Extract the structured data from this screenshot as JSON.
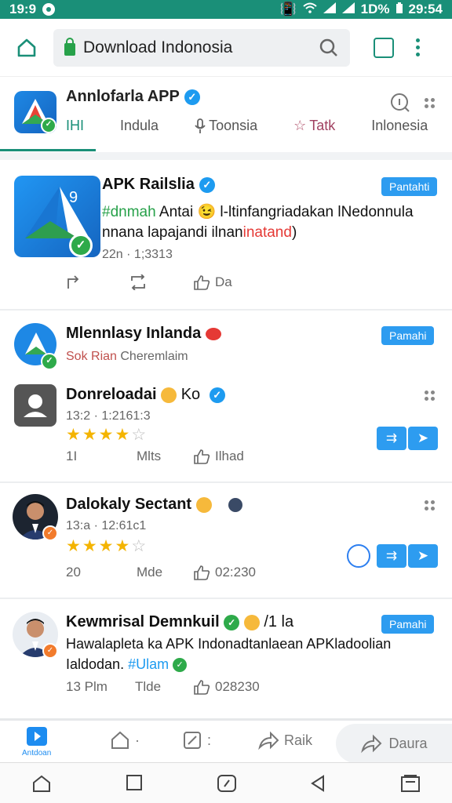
{
  "status_bar": {
    "time": "19:9",
    "battery": "1D%",
    "clock": "29:54"
  },
  "url_bar": {
    "url": "Download Indonosia"
  },
  "app_header": {
    "title": "Annlofarla APP",
    "tabs": [
      {
        "label": "IHI",
        "icon": "home-icon"
      },
      {
        "label": "Indula",
        "icon": ""
      },
      {
        "label": "Toonsia",
        "icon": "microphone-icon"
      },
      {
        "label": "Tatk",
        "icon": "star-icon"
      },
      {
        "label": "Inlonesia",
        "icon": ""
      }
    ]
  },
  "posts": [
    {
      "name": "APK Railslia",
      "tag": "Pantahti",
      "text_line1_prefix": "#dnmah",
      "text_line1": " Antai 😉 l-ltinfangriadakan lNedonnula",
      "text_line2_prefix": "nnana lapajandi ilnan",
      "text_line2_red": "inatand",
      "text_line2_suffix": ")",
      "meta": "22n  ·  1;3313",
      "actions": {
        "like": "Da"
      }
    },
    {
      "name": "Mlennlasy Inlanda",
      "tag": "Pamahi",
      "subtitle_red": "Sok Rian",
      "subtitle": " Cheremlaim"
    },
    {
      "name": "Donreloadai",
      "name_suffix": "Ko",
      "meta": "13:2 · 1:2161:3",
      "rating": 4,
      "stats": [
        "1I",
        "Mlts",
        "Ilhad"
      ]
    },
    {
      "name": "Dalokaly Sectant",
      "meta": "13:a · 12:61c1",
      "rating": 4,
      "stats": [
        "20",
        "Mde",
        "02:230"
      ]
    },
    {
      "name": "Kewmrisal Demnkuil",
      "name_suffix": "/1 la",
      "tag": "Pamahi",
      "text_line1": "Hawalapleta ka APK Indonadtanlaean APKladoolian",
      "text_line2_prefix": "Ialdodan. ",
      "text_line2_link": "#Ulam",
      "meta_left": "13 Plm",
      "meta_mid": "Tlde",
      "meta_right": "028230"
    }
  ],
  "bottom_nav": {
    "items": [
      {
        "label": "Antdoan"
      },
      {
        "label": "·"
      },
      {
        "label": ":"
      },
      {
        "label": "Raik"
      },
      {
        "label": "Daura"
      }
    ]
  }
}
